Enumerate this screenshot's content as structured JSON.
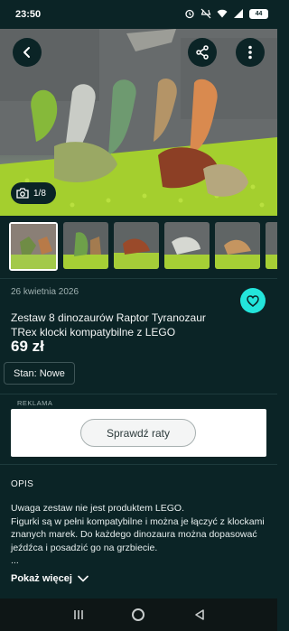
{
  "status_bar": {
    "time": "23:50",
    "battery": "44",
    "icons": [
      "alarm-icon",
      "mute-icon",
      "wifi-icon",
      "signal-icon",
      "battery-icon"
    ]
  },
  "gallery": {
    "counter": "1/8",
    "thumbnails_count": 5
  },
  "listing": {
    "date": "26 kwietnia 2026",
    "title": "Zestaw 8 dinozaurów Raptor Tyranozaur TRex klocki kompatybilne z LEGO",
    "price": "69 zł",
    "condition_chip": "Stan: Nowe"
  },
  "ad": {
    "label": "REKLAMA",
    "cta": "Sprawdź raty"
  },
  "description": {
    "heading": "OPIS",
    "line1": "Uwaga zestaw nie jest produktem LEGO.",
    "line2": "Figurki są w pełni kompatybilne i można je łączyć z klockami znanych marek. Do każdego dinozaura można dopasować jeźdźca i posadzić go na grzbiecie.",
    "ellipsis": "...",
    "show_more": "Pokaż więcej"
  },
  "colors": {
    "background": "#0b2426",
    "accent": "#23e5db",
    "ad_background": "#ffffff"
  }
}
